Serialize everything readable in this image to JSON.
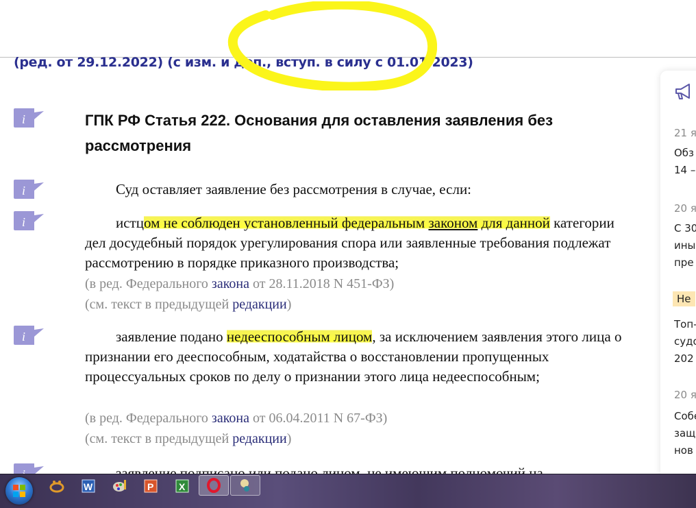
{
  "document": {
    "edition_line": "(ред. от 29.12.2022) (с изм. и доп., вступ. в силу с 01.01.2023)",
    "article_title": "ГПК РФ Статья 222. Основания для оставления заявления без рассмотрения",
    "intro": "Суд оставляет заявление без рассмотрения в случае, если:",
    "items": [
      {
        "pre": "истц",
        "highlight_a": "ом не соблюден установленный федеральным ",
        "link": "законом",
        "highlight_b": " для данной",
        "post": " категории дел досудебный порядок урегулирования спора или заявленные требования подлежат рассмотрению в порядке приказного производства;",
        "note_prefix": "(в ред. Федерального ",
        "note_link": "закона",
        "note_suffix": " от 28.11.2018 N 451-ФЗ)",
        "prev_prefix": "(см. текст в предыдущей ",
        "prev_link": "редакции",
        "prev_suffix": ")"
      },
      {
        "pre": "заявление подано ",
        "highlight": "недееспособным лицом",
        "post": ", за исключением заявления этого лица о признании его дееспособным, ходатайства о восстановлении пропущенных процессуальных сроков по делу о признании этого лица недееспособным;",
        "note_prefix": "(в ред. Федерального ",
        "note_link": "закона",
        "note_suffix": " от 06.04.2011 N 67-ФЗ)",
        "prev_prefix": "(см. текст в предыдущей ",
        "prev_link": "редакции",
        "prev_suffix": ")"
      },
      {
        "text": "заявление подписано или подано лицом, не имеющим полномочий на"
      }
    ]
  },
  "sidebar": {
    "icon": "megaphone-icon",
    "news": [
      {
        "date": "21 я",
        "lines": [
          "Обз",
          "14 –"
        ]
      },
      {
        "date": "20 я",
        "lines": [
          "С 30",
          "ины",
          "пре"
        ]
      },
      {
        "badge": "Не",
        "lines": [
          "Топ-",
          "судо",
          "202"
        ]
      },
      {
        "date": "20 я",
        "lines": [
          "Собе",
          "защ",
          "нов"
        ]
      }
    ]
  },
  "taskbar": {
    "apps": [
      "start-orb",
      "xnview",
      "word",
      "paint",
      "powerpoint",
      "excel",
      "opera",
      "app-globe"
    ]
  },
  "colors": {
    "edition": "#2a2f8f",
    "highlight": "#ffff3a",
    "info_icon": "#9b97d6",
    "link": "#2a2d78",
    "note": "#8a8a8a"
  }
}
